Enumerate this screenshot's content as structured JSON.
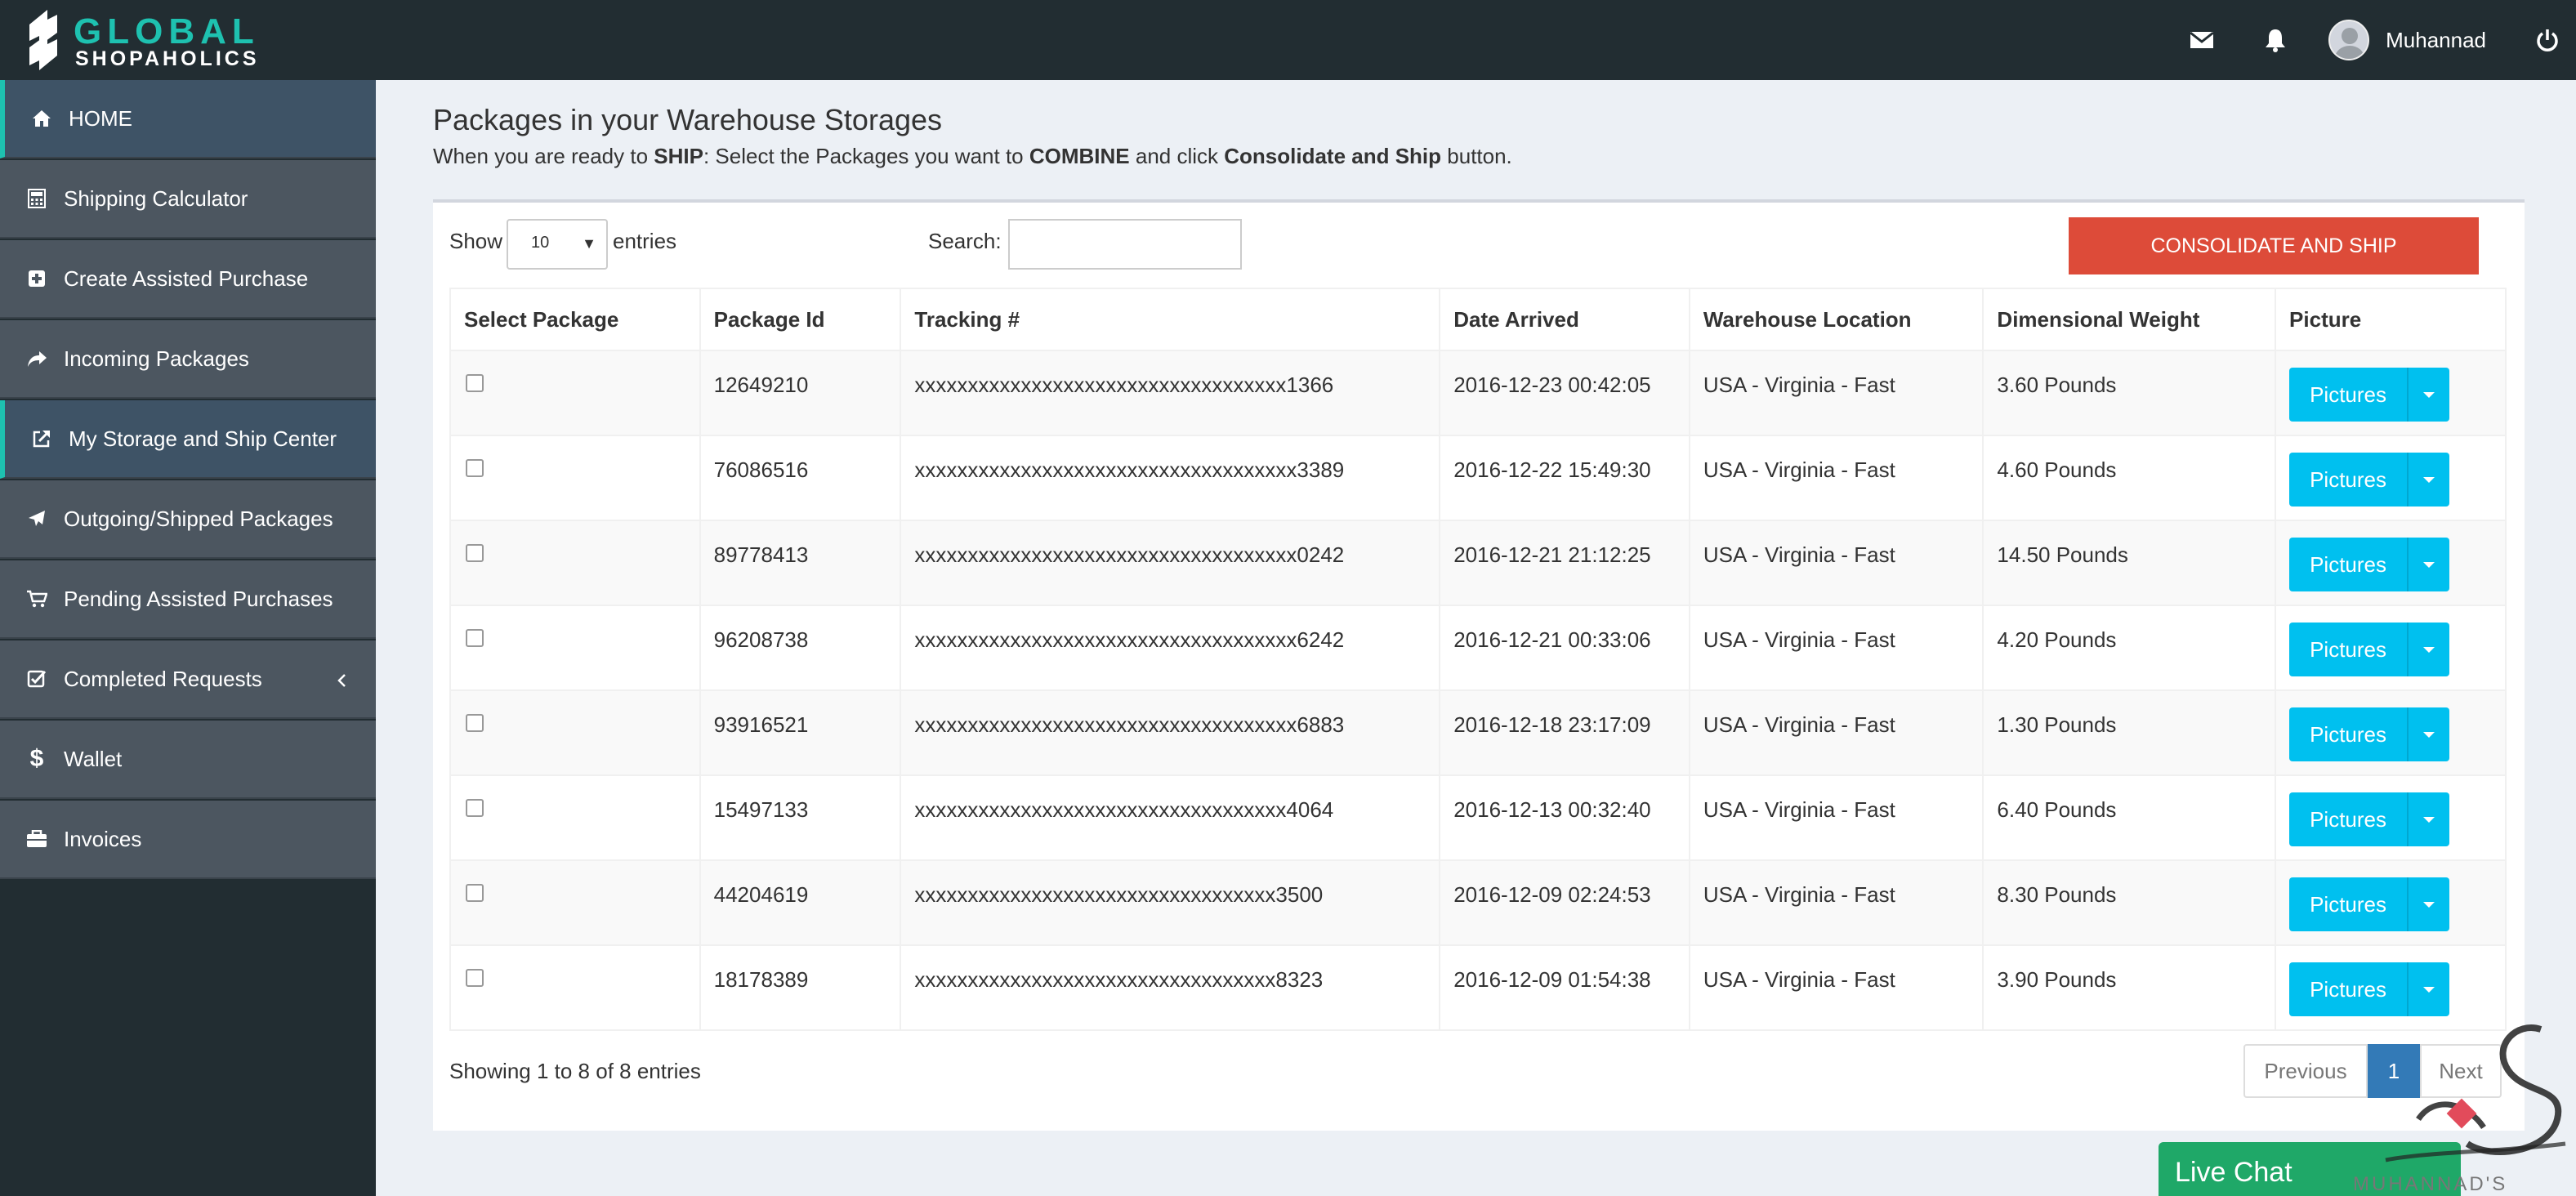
{
  "brand": {
    "logo_line1": "GLOBAL",
    "logo_line2": "SHOPAHOLICS",
    "accent_color": "#1ec1b0"
  },
  "topbar": {
    "mail_icon": "envelope-icon",
    "notification_icon": "bell-icon",
    "user_name": "Muhannad",
    "power_icon": "power-icon"
  },
  "sidebar": {
    "items": [
      {
        "label": "HOME",
        "icon": "home-icon",
        "active": true
      },
      {
        "label": "Shipping Calculator",
        "icon": "calculator-icon"
      },
      {
        "label": "Create Assisted Purchase",
        "icon": "plus-square-icon"
      },
      {
        "label": "Incoming Packages",
        "icon": "share-arrow-icon"
      },
      {
        "label": "My Storage and Ship Center",
        "icon": "external-link-icon",
        "active": true
      },
      {
        "label": "Outgoing/Shipped Packages",
        "icon": "plane-icon"
      },
      {
        "label": "Pending Assisted Purchases",
        "icon": "cart-icon"
      },
      {
        "label": "Completed Requests",
        "icon": "check-square-icon"
      },
      {
        "label": "Wallet",
        "icon": "dollar-icon"
      },
      {
        "label": "Invoices",
        "icon": "briefcase-icon"
      }
    ]
  },
  "page": {
    "title": "Packages in your Warehouse Storages",
    "sub_1": "When you are ready to ",
    "sub_ship": "SHIP",
    "sub_2": ": Select the Packages you want to ",
    "sub_combine": "COMBINE",
    "sub_3": " and click ",
    "sub_cs": "Consolidate and Ship",
    "sub_4": " button."
  },
  "controls": {
    "show_label": "Show",
    "entries_value": "10",
    "entries_label": "entries",
    "search_label": "Search:",
    "search_value": "",
    "consolidate_label": "CONSOLIDATE AND SHIP"
  },
  "table": {
    "headers": [
      "Select Package",
      "Package Id",
      "Tracking #",
      "Date Arrived",
      "Warehouse Location",
      "Dimensional Weight",
      "Picture"
    ],
    "rows": [
      {
        "id": "12649210",
        "tracking": "xxxxxxxxxxxxxxxxxxxxxxxxxxxxxxxxxxx1366",
        "date": "2016-12-23 00:42:05",
        "location": "USA - Virginia - Fast",
        "weight": "3.60 Pounds",
        "button": "Pictures"
      },
      {
        "id": "76086516",
        "tracking": "xxxxxxxxxxxxxxxxxxxxxxxxxxxxxxxxxxxx3389",
        "date": "2016-12-22 15:49:30",
        "location": "USA - Virginia - Fast",
        "weight": "4.60 Pounds",
        "button": "Pictures"
      },
      {
        "id": "89778413",
        "tracking": "xxxxxxxxxxxxxxxxxxxxxxxxxxxxxxxxxxxx0242",
        "date": "2016-12-21 21:12:25",
        "location": "USA - Virginia - Fast",
        "weight": "14.50 Pounds",
        "button": "Pictures"
      },
      {
        "id": "96208738",
        "tracking": "xxxxxxxxxxxxxxxxxxxxxxxxxxxxxxxxxxxx6242",
        "date": "2016-12-21 00:33:06",
        "location": "USA - Virginia - Fast",
        "weight": "4.20 Pounds",
        "button": "Pictures"
      },
      {
        "id": "93916521",
        "tracking": "xxxxxxxxxxxxxxxxxxxxxxxxxxxxxxxxxxxx6883",
        "date": "2016-12-18 23:17:09",
        "location": "USA - Virginia - Fast",
        "weight": "1.30 Pounds",
        "button": "Pictures"
      },
      {
        "id": "15497133",
        "tracking": "xxxxxxxxxxxxxxxxxxxxxxxxxxxxxxxxxxx4064",
        "date": "2016-12-13 00:32:40",
        "location": "USA - Virginia - Fast",
        "weight": "6.40 Pounds",
        "button": "Pictures"
      },
      {
        "id": "44204619",
        "tracking": "xxxxxxxxxxxxxxxxxxxxxxxxxxxxxxxxxx3500",
        "date": "2016-12-09 02:24:53",
        "location": "USA - Virginia - Fast",
        "weight": "8.30 Pounds",
        "button": "Pictures"
      },
      {
        "id": "18178389",
        "tracking": "xxxxxxxxxxxxxxxxxxxxxxxxxxxxxxxxxx8323",
        "date": "2016-12-09 01:54:38",
        "location": "USA - Virginia - Fast",
        "weight": "3.90 Pounds",
        "button": "Pictures"
      }
    ]
  },
  "footer": {
    "showing": "Showing 1 to 8 of 8 entries",
    "prev": "Previous",
    "page": "1",
    "next": "Next"
  },
  "livechat": {
    "label": "Live Chat",
    "color": "#1fa868"
  },
  "watermark": {
    "text": "MUHANNAD'S BLOG"
  }
}
